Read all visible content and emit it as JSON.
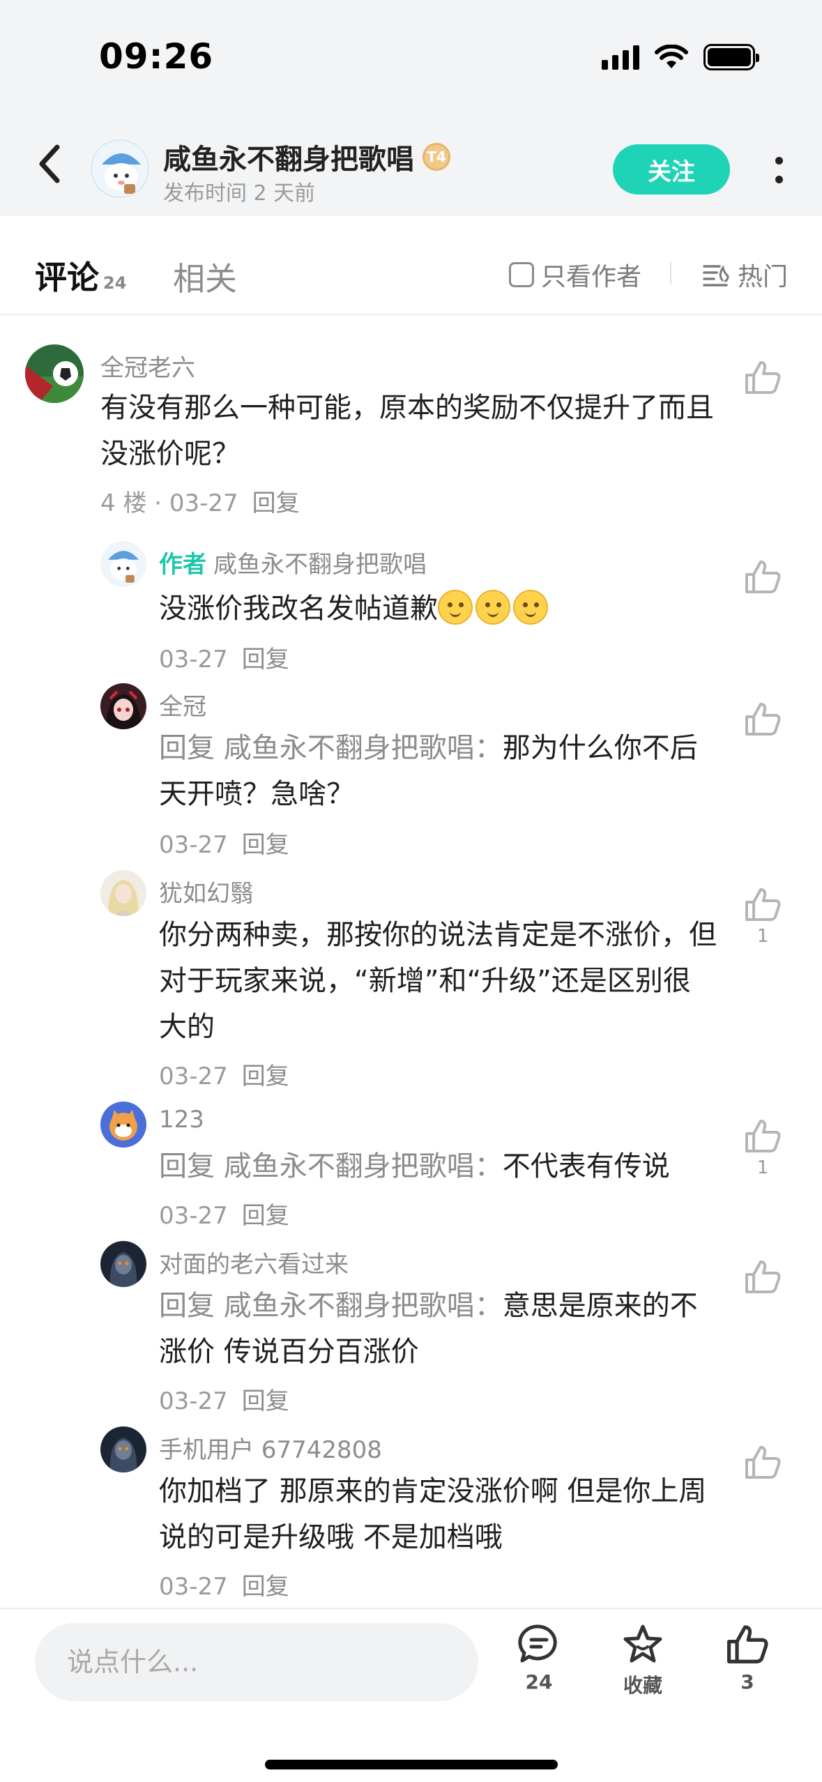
{
  "status_bar": {
    "time": "09:26"
  },
  "header": {
    "author_name": "咸鱼永不翻身把歌唱",
    "level_badge": "T4",
    "post_time": "发布时间 2 天前",
    "follow_label": "关注"
  },
  "tabs": {
    "comments_label": "评论",
    "comments_count": "24",
    "related_label": "相关",
    "only_author_label": "只看作者",
    "sort_label": "热门"
  },
  "comments": [
    {
      "user": "全冠老六",
      "text": "有没有那么一种可能，原本的奖励不仅提升了而且没涨价呢？",
      "meta": "4 楼 · 03-27",
      "reply": "回复",
      "likes": ""
    },
    {
      "author_tag": "作者",
      "user": "咸鱼永不翻身把歌唱",
      "text": "没涨价我改名发帖道歉",
      "date": "03-27",
      "reply": "回复",
      "likes": ""
    },
    {
      "user": "全冠",
      "reply_prefix": "回复 咸鱼永不翻身把歌唱：",
      "text": "那为什么你不后天开喷？急啥？",
      "date": "03-27",
      "reply": "回复",
      "likes": ""
    },
    {
      "user": "犹如幻翳",
      "text": "你分两种卖，那按你的说法肯定是不涨价，但对于玩家来说，“新增”和“升级”还是区别很大的",
      "date": "03-27",
      "reply": "回复",
      "likes": "1"
    },
    {
      "user": "123",
      "reply_prefix": "回复 咸鱼永不翻身把歌唱：",
      "text": "不代表有传说",
      "date": "03-27",
      "reply": "回复",
      "likes": "1"
    },
    {
      "user": "对面的老六看过来",
      "reply_prefix": "回复 咸鱼永不翻身把歌唱：",
      "text": "意思是原来的不涨价 传说百分百涨价",
      "date": "03-27",
      "reply": "回复",
      "likes": ""
    },
    {
      "user": "手机用户 67742808",
      "text": "你加档了 那原来的肯定没涨价啊 但是你上周说的可是升级哦 不是加档哦",
      "date": "03-27",
      "reply": "回复",
      "likes": ""
    }
  ],
  "bottom_bar": {
    "input_placeholder": "说点什么...",
    "comment_count": "24",
    "favorite_label": "收藏",
    "like_count": "3"
  },
  "colors": {
    "accent": "#1ed3b6",
    "author_tag": "#1ec6ab",
    "muted_text": "#8c8c8c",
    "header_bg": "#f3f4f6"
  },
  "icons": [
    "back-arrow-icon",
    "signal-icon",
    "wifi-icon",
    "battery-icon",
    "more-dots-icon",
    "checkbox-icon",
    "sort-hot-icon",
    "thumbs-up-icon",
    "comment-bubble-icon",
    "star-icon",
    "smile-emoji-icon"
  ]
}
